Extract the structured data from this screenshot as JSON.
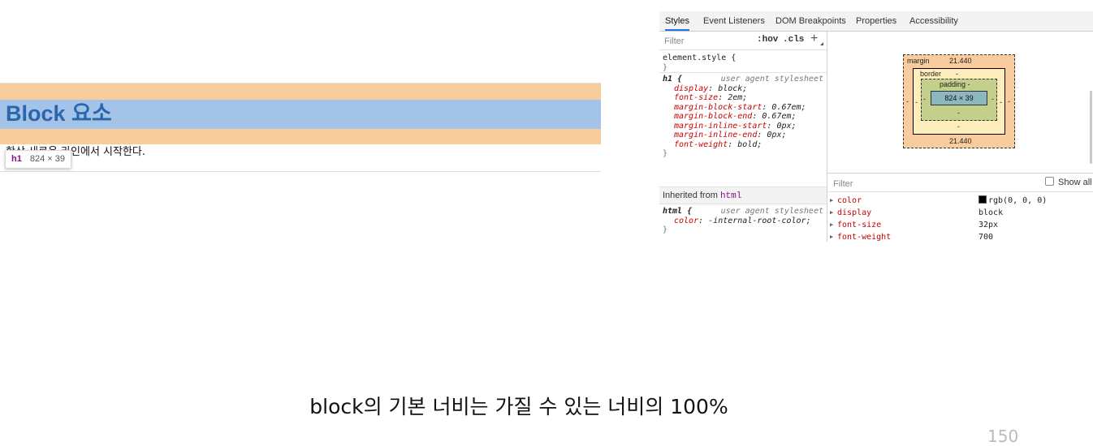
{
  "demo": {
    "heading": "Block 요소",
    "paragraph": "항상 새로운 라인에서 시작한다.",
    "tooltip": {
      "tag": "h1",
      "size": "824 × 39"
    }
  },
  "devtools": {
    "tabs": [
      "Styles",
      "Event Listeners",
      "DOM Breakpoints",
      "Properties",
      "Accessibility"
    ],
    "active_tab": "Styles",
    "styles": {
      "filter_placeholder": "Filter",
      "hov": ":hov",
      "cls": ".cls",
      "add": "+",
      "element_style_selector": "element.style {",
      "close_brace": "}",
      "h1_rule": {
        "selector": "h1 {",
        "source": "user agent stylesheet",
        "declarations": [
          {
            "prop": "display",
            "value": "block;"
          },
          {
            "prop": "font-size",
            "value": "2em;"
          },
          {
            "prop": "margin-block-start",
            "value": "0.67em;"
          },
          {
            "prop": "margin-block-end",
            "value": "0.67em;"
          },
          {
            "prop": "margin-inline-start",
            "value": "0px;"
          },
          {
            "prop": "margin-inline-end",
            "value": "0px;"
          },
          {
            "prop": "font-weight",
            "value": "bold;"
          }
        ]
      },
      "inherited_label": "Inherited from",
      "inherited_tag": "html",
      "html_rule": {
        "selector": "html {",
        "source": "user agent stylesheet",
        "declarations": [
          {
            "prop": "color",
            "value": "-internal-root-color;"
          }
        ]
      }
    },
    "box_model": {
      "margin_label": "margin",
      "margin_top": "21.440",
      "margin_bottom": "21.440",
      "margin_side": "-",
      "border_label": "border",
      "border_value": "-",
      "padding_label": "padding -",
      "padding_value": "-",
      "content": "824 × 39"
    },
    "computed": {
      "filter_placeholder": "Filter",
      "show_all": "Show all",
      "properties": [
        {
          "name": "color",
          "value": "rgb(0, 0, 0)",
          "swatch": "#000000"
        },
        {
          "name": "display",
          "value": "block"
        },
        {
          "name": "font-size",
          "value": "32px"
        },
        {
          "name": "font-weight",
          "value": "700"
        }
      ]
    }
  },
  "caption": "block의 기본 너비는 가질 수 있는 너비의 100%",
  "page_number": "150",
  "colors": {
    "margin": "#f9cc9d",
    "content": "#a3c4e8",
    "heading_text": "#2b66ad",
    "tab_accent": "#1a73e8",
    "css_property": "#c80000"
  }
}
